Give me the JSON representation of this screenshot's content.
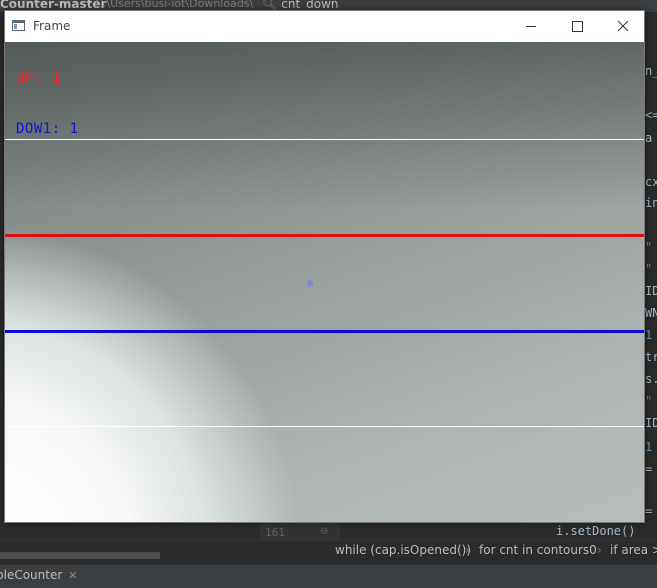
{
  "ide": {
    "project_title": "Counter-master",
    "project_path": "C:\\Users\\busi-iot\\Downloads\\",
    "search_text": "cnt_down",
    "line_number": "161",
    "code_bottom": "i.setDone()",
    "right_snippets": [
      "n_",
      "<=",
      "a",
      "cx",
      "in",
      "\"",
      "\"",
      "ID",
      "WN",
      "1",
      "tr",
      "s.",
      "\"",
      "ID",
      "1",
      "=",
      "="
    ],
    "breadcrumbs": [
      "while (cap.isOpened())",
      "for cnt in contours0",
      "if area >"
    ],
    "run_tab_label": "pleCounter"
  },
  "frame": {
    "title": "Frame",
    "overlay": {
      "up_text": "UP: 1",
      "down_text": "DOW1: 1"
    }
  },
  "colors": {
    "up_line": "#e01010",
    "down_line": "#0a0adc",
    "limit_line": "#ffffff",
    "up_text": "#ff2020",
    "down_text": "#1010e0"
  }
}
